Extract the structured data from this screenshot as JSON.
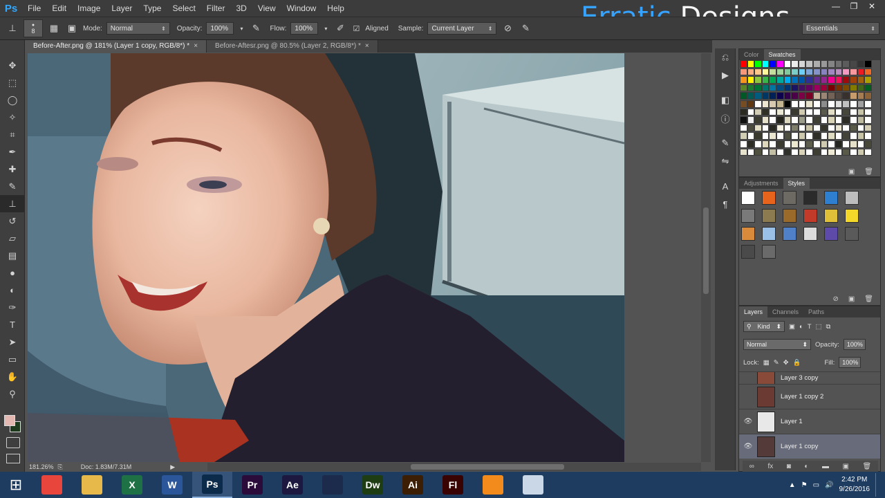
{
  "app": {
    "logo": "Ps",
    "watermark_a": "Erratic",
    "watermark_b": " Designs"
  },
  "menu": [
    "File",
    "Edit",
    "Image",
    "Layer",
    "Type",
    "Select",
    "Filter",
    "3D",
    "View",
    "Window",
    "Help"
  ],
  "window_controls": {
    "minimize": "—",
    "restore": "❐",
    "close": "✕"
  },
  "options_bar": {
    "brush_size": "8",
    "mode_label": "Mode:",
    "mode_value": "Normal",
    "opacity_label": "Opacity:",
    "opacity_value": "100%",
    "flow_label": "Flow:",
    "flow_value": "100%",
    "aligned_label": "Aligned",
    "sample_label": "Sample:",
    "sample_value": "Current Layer",
    "workspace": "Essentials"
  },
  "tabs": [
    {
      "label": "Before-After.png @ 181% (Layer 1 copy, RGB/8*) *",
      "close": "×"
    },
    {
      "label": "Before-Aftesr.png @ 80.5% (Layer 2, RGB/8*) *",
      "close": "×"
    }
  ],
  "status": {
    "zoom": "181.26%",
    "doc": "Doc: 1.83M/7.31M"
  },
  "swatches_panel": {
    "tabs": [
      "Color",
      "Swatches"
    ]
  },
  "styles_panel": {
    "tabs": [
      "Adjustments",
      "Styles"
    ]
  },
  "layers_panel": {
    "tabs": [
      "Layers",
      "Channels",
      "Paths"
    ],
    "kind": "Kind",
    "blend": "Normal",
    "opacity_label": "Opacity:",
    "opacity_value": "100%",
    "lock_label": "Lock:",
    "fill_label": "Fill:",
    "fill_value": "100%",
    "layers": [
      {
        "name": "Layer 3 copy",
        "visible": false,
        "selected": false
      },
      {
        "name": "Layer 1 copy 2",
        "visible": false,
        "selected": false
      },
      {
        "name": "Layer 1",
        "visible": true,
        "selected": false
      },
      {
        "name": "Layer 1 copy",
        "visible": true,
        "selected": true
      }
    ]
  },
  "taskbar": {
    "apps": [
      {
        "name": "chrome",
        "label": "",
        "color": "#e8453c"
      },
      {
        "name": "explorer",
        "label": "",
        "color": "#e7b84a"
      },
      {
        "name": "excel",
        "label": "X",
        "color": "#1e7145"
      },
      {
        "name": "word",
        "label": "W",
        "color": "#2b579a"
      },
      {
        "name": "photoshop",
        "label": "Ps",
        "color": "#0c2b4a"
      },
      {
        "name": "premiere",
        "label": "Pr",
        "color": "#2a0b3a"
      },
      {
        "name": "after-effects",
        "label": "Ae",
        "color": "#1c1840"
      },
      {
        "name": "cinema4d",
        "label": "",
        "color": "#1c2b4b"
      },
      {
        "name": "dreamweaver",
        "label": "Dw",
        "color": "#1e3d12"
      },
      {
        "name": "illustrator",
        "label": "Ai",
        "color": "#3b1e03"
      },
      {
        "name": "flash",
        "label": "Fl",
        "color": "#3a0303"
      },
      {
        "name": "media-player",
        "label": "",
        "color": "#f28b1b"
      },
      {
        "name": "recorder",
        "label": "",
        "color": "#c9d7e6"
      }
    ],
    "time": "2:42 PM",
    "date": "9/26/2016"
  }
}
